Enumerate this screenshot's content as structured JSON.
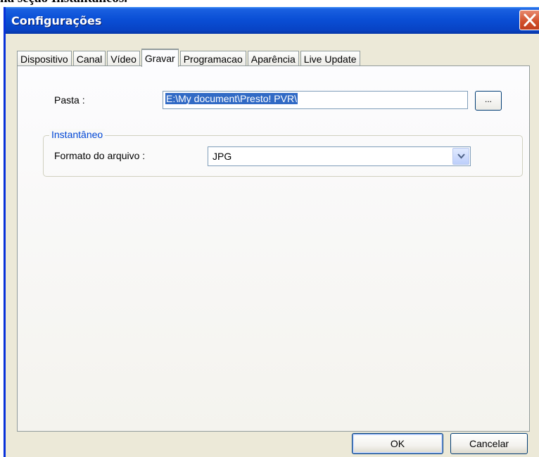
{
  "page_heading_fragment": "na seção Instantâneos.",
  "window": {
    "title": "Configurações"
  },
  "tabs": [
    {
      "label": "Dispositivo",
      "active": false
    },
    {
      "label": "Canal",
      "active": false
    },
    {
      "label": "Vídeo",
      "active": false
    },
    {
      "label": "Gravar",
      "active": true
    },
    {
      "label": "Programacao",
      "active": false
    },
    {
      "label": "Aparência",
      "active": false
    },
    {
      "label": "Live Update",
      "active": false
    }
  ],
  "folder": {
    "label": "Pasta :",
    "value": "E:\\My document\\Presto! PVR\\",
    "browse_label": "..."
  },
  "snapshot_group": {
    "title": "Instantâneo",
    "format_label": "Formato do arquivo :",
    "format_value": "JPG"
  },
  "buttons": {
    "ok": "OK",
    "cancel": "Cancelar"
  },
  "colors": {
    "title_bar": "#0a4fd6",
    "close_button": "#d04e2a",
    "group_title": "#0046d5",
    "selection": "#316ac5"
  },
  "icons": {
    "close": "close-icon",
    "dropdown": "chevron-down-icon"
  }
}
